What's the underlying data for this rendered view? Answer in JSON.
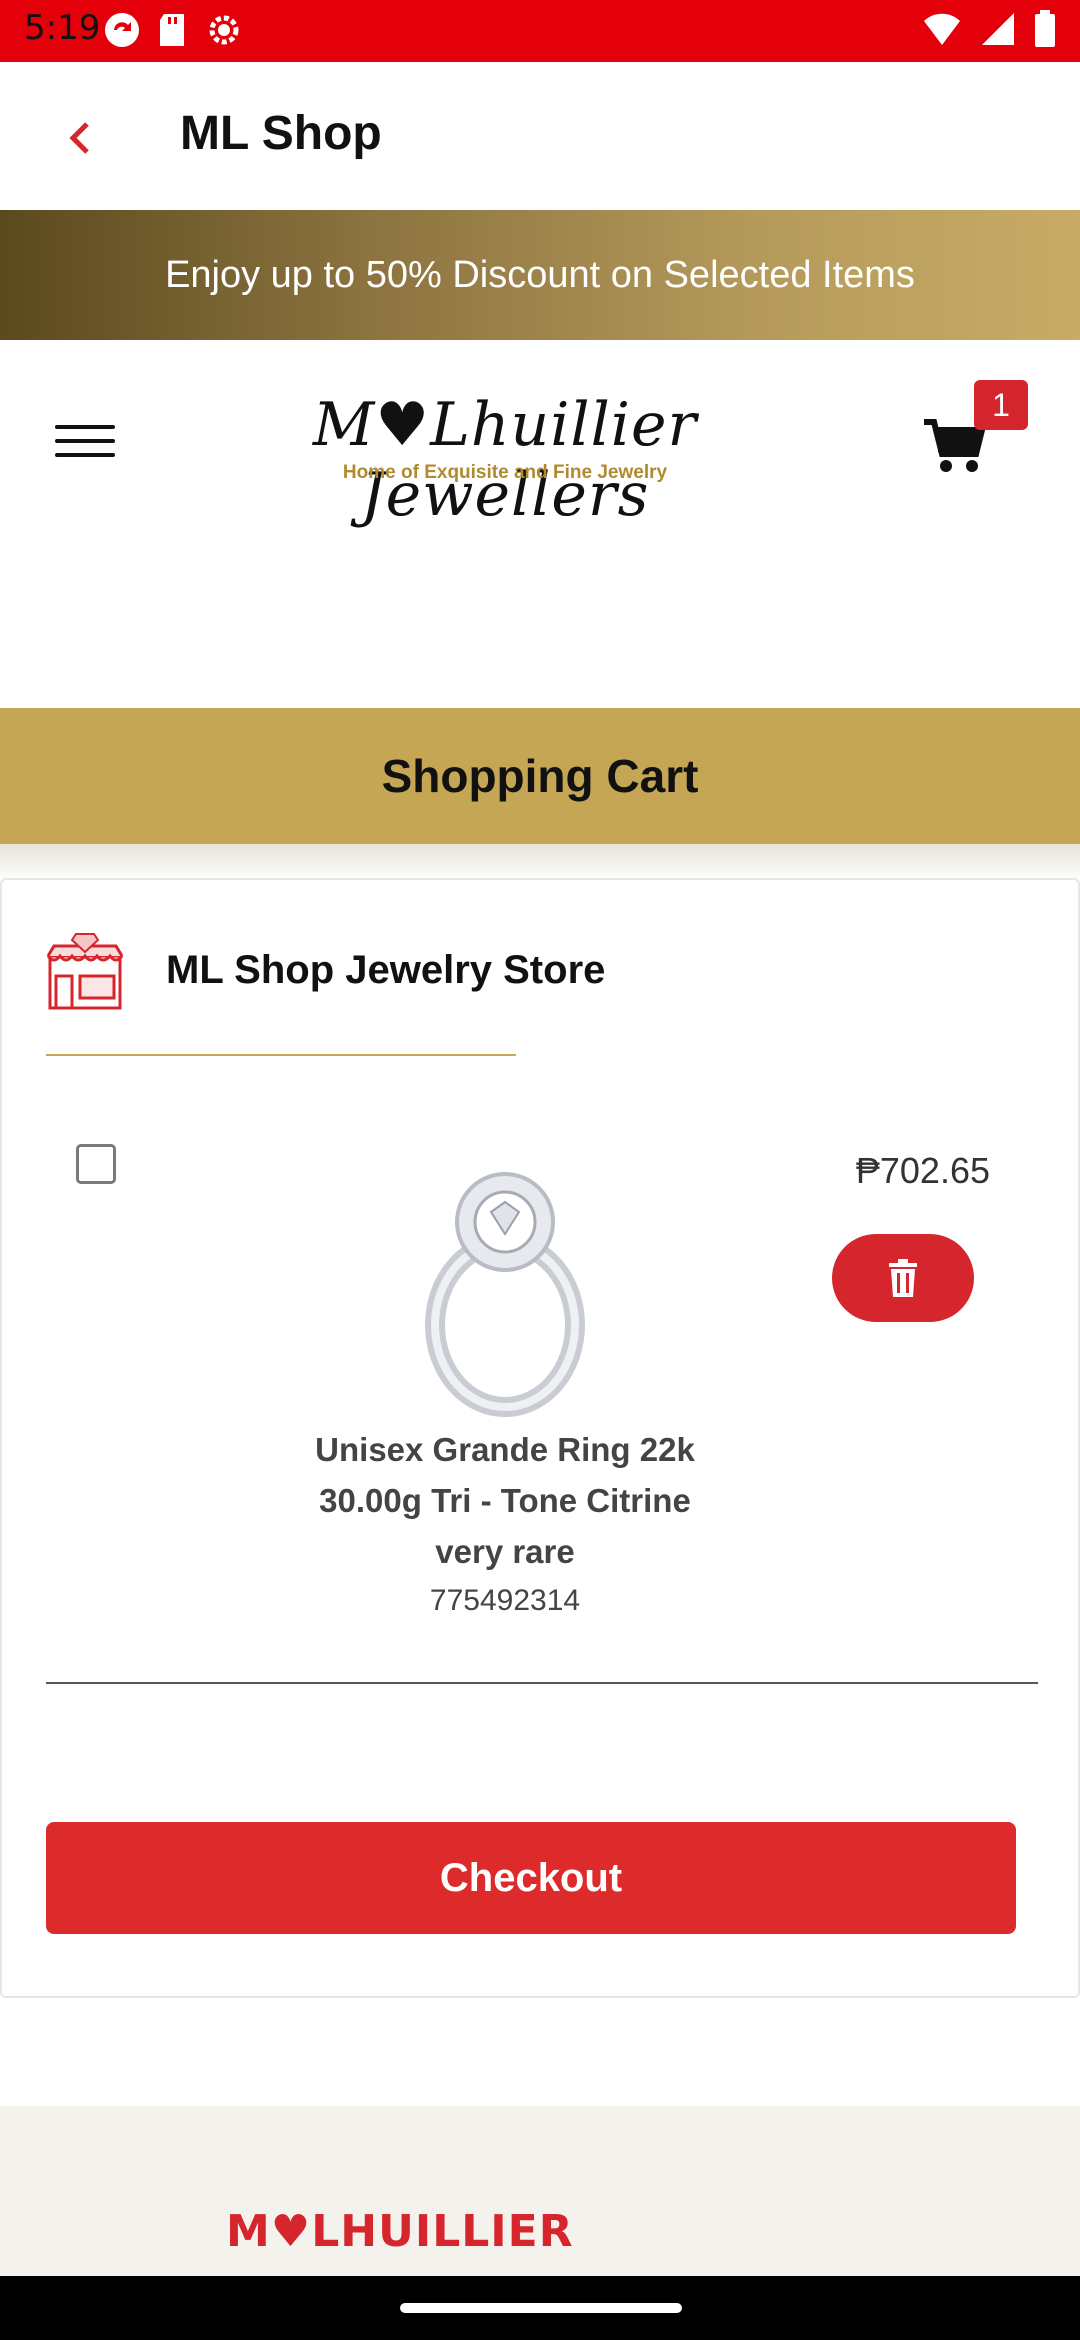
{
  "status_bar": {
    "time": "5:19"
  },
  "app_bar": {
    "title": "ML Shop"
  },
  "promo": {
    "text": "Enjoy up to 50% Discount on Selected Items"
  },
  "header": {
    "logo_text": "M♥Lhuillier Jewellers",
    "logo_tagline": "Home of Exquisite and Fine Jewelry",
    "cart_count": "1"
  },
  "cart": {
    "title": "Shopping Cart",
    "store_name": "ML Shop Jewelry Store",
    "items": [
      {
        "name": "Unisex Grande Ring 22k 30.00g Tri - Tone Citrine very rare",
        "sku": "775492314",
        "price": "₱702.65"
      }
    ],
    "checkout_label": "Checkout"
  },
  "footer": {
    "logo_text": "M♥LHUILLIER"
  },
  "colors": {
    "accent": "#d4262c",
    "gold": "#c5a655",
    "status_red": "#e4000b"
  }
}
